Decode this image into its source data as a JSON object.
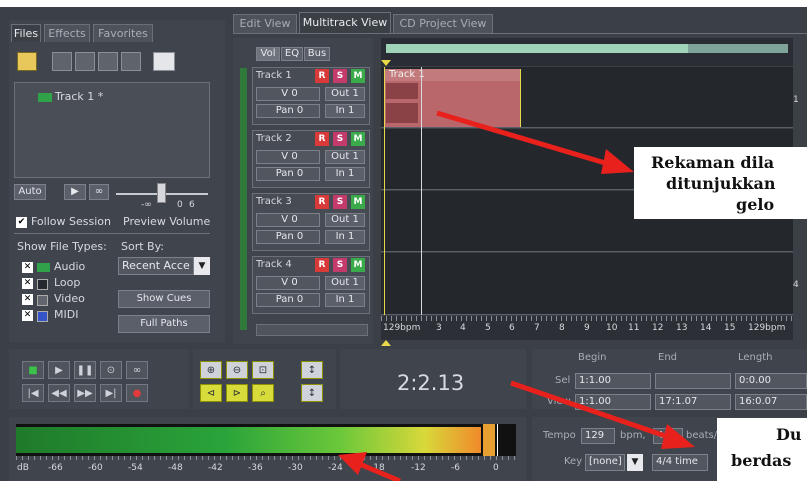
{
  "file_panel": {
    "tabs": [
      "Files",
      "Effects",
      "Favorites"
    ],
    "file_item": "Track 1 *",
    "auto_label": "Auto",
    "follow_session": "Follow Session",
    "preview_volume": "Preview Volume",
    "show_file_types": "Show File Types:",
    "sort_by": "Sort By:",
    "sort_value": "Recent Acce",
    "types": [
      "Audio",
      "Loop",
      "Video",
      "MIDI"
    ],
    "show_cues": "Show Cues",
    "full_paths": "Full Paths",
    "vol_ticks": [
      "-∞",
      "0",
      "6"
    ]
  },
  "view_tabs": [
    "Edit View",
    "Multitrack View",
    "CD Project View"
  ],
  "mix_tabs": [
    "Vol",
    "EQ",
    "Bus"
  ],
  "tracks": [
    {
      "name": "Track 1",
      "vol": "V 0",
      "pan": "Pan 0",
      "out": "Out 1",
      "in": "In 1"
    },
    {
      "name": "Track 2",
      "vol": "V 0",
      "pan": "Pan 0",
      "out": "Out 1",
      "in": "In 1"
    },
    {
      "name": "Track 3",
      "vol": "V 0",
      "pan": "Pan 0",
      "out": "Out 1",
      "in": "In 1"
    },
    {
      "name": "Track 4",
      "vol": "V 0",
      "pan": "Pan 0",
      "out": "Out 1",
      "in": "In 1"
    }
  ],
  "rsm": [
    "R",
    "S",
    "M"
  ],
  "clip_label": "Track 1",
  "lane_numbers": [
    "1",
    "4"
  ],
  "ruler": [
    "129bpm",
    "3",
    "4",
    "5",
    "6",
    "7",
    "8",
    "9",
    "10",
    "11",
    "12",
    "13",
    "14",
    "15",
    "129bpm"
  ],
  "time_display": "2:2.13",
  "selection": {
    "headers": [
      "Begin",
      "End",
      "Length"
    ],
    "sel_label": "Sel",
    "view_label": "View",
    "sel": [
      "1:1.00",
      "",
      "0:0.00"
    ],
    "view": [
      "1:1.00",
      "17:1.07",
      "16:0.07"
    ]
  },
  "tempo": {
    "label": "Tempo",
    "value": "129",
    "unit": "bpm,",
    "beats": "4",
    "beats_unit": "beats/"
  },
  "key": {
    "label": "Key",
    "value": "[none]",
    "time_sig": "4/4 time"
  },
  "meter_ticks": [
    "dB",
    "-66",
    "-60",
    "-54",
    "-48",
    "-42",
    "-36",
    "-30",
    "-24",
    "-18",
    "-12",
    "-6",
    "0"
  ],
  "annotations": {
    "a1_line1": "Rekaman dila",
    "a1_line2": "ditunjukkan",
    "a1_line3": "gelo",
    "a2_line1": "Du",
    "a2_line2": "berdas"
  },
  "colors": {
    "record": "#e03a3a",
    "solo": "#3a9a3a",
    "mute": "#3ab04a",
    "clip": "#c06a6a",
    "arrow": "#e8211d"
  }
}
